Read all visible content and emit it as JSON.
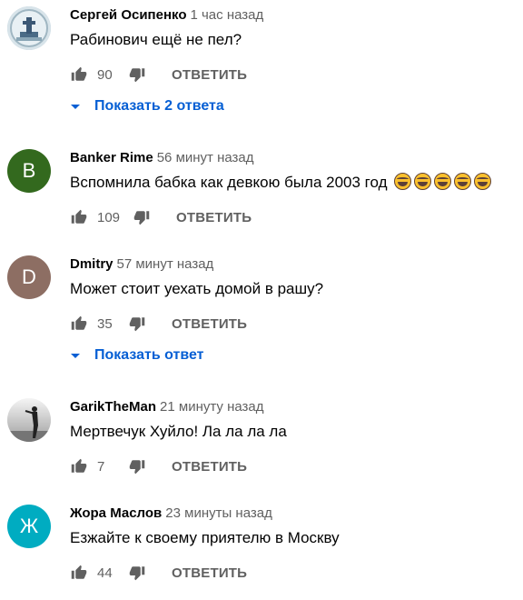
{
  "comments": [
    {
      "author": "Сергей Осипенко",
      "time": "1 час назад",
      "text": "Рабинович ещё не пел?",
      "likes": "90",
      "reply_label": "ОТВЕТИТЬ",
      "replies_label": "Показать 2 ответа",
      "avatar_icon": "photo-avatar"
    },
    {
      "author": "Banker Rime",
      "time": "56 минут назад",
      "text": "Вспомнила бабка как девкою была 2003 год",
      "emoji_count": 5,
      "likes": "109",
      "reply_label": "ОТВЕТИТЬ",
      "avatar_letter": "B",
      "avatar_color": "#33691e"
    },
    {
      "author": "Dmitry",
      "time": "57 минут назад",
      "text": "Может стоит уехать домой в рашу?",
      "likes": "35",
      "reply_label": "ОТВЕТИТЬ",
      "replies_label": "Показать ответ",
      "avatar_letter": "D",
      "avatar_color": "#8d6e63"
    },
    {
      "author": "GarikTheMan",
      "time": "21 минуту назад",
      "text": "Мертвечук Хуйло! Ла ла ла ла",
      "likes": "7",
      "reply_label": "ОТВЕТИТЬ",
      "avatar_icon": "photo-avatar"
    },
    {
      "author": "Жора Маслов",
      "time": "23 минуты назад",
      "text": "Езжайте к своему приятелю в Москву",
      "likes": "44",
      "reply_label": "ОТВЕТИТЬ",
      "avatar_letter": "Ж",
      "avatar_color": "#00acc1"
    }
  ],
  "colors": {
    "link": "#065fd4",
    "secondary_text": "#606060",
    "primary_text": "#030303"
  }
}
